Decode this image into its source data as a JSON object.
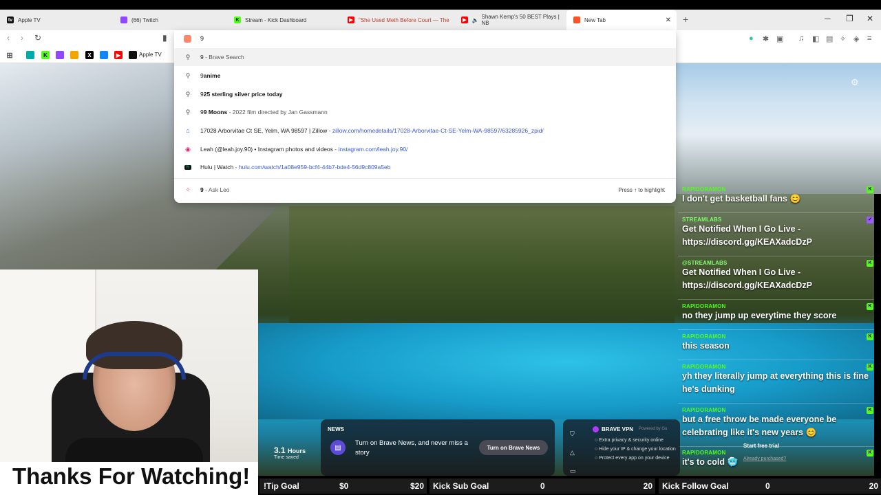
{
  "tabs": [
    {
      "label": "Apple TV",
      "icon": "apple-tv-icon",
      "color": "#111111"
    },
    {
      "label": "(66) Twitch",
      "icon": "twitch-icon",
      "color": "#9146ff"
    },
    {
      "label": "Stream - Kick Dashboard",
      "icon": "kick-icon",
      "color": "#53fc18"
    },
    {
      "label": "\"She Used Meth Before Court — The",
      "icon": "youtube-icon",
      "color": "#ff0000"
    },
    {
      "label": "Shawn Kemp's 50 BEST Plays | NB",
      "icon": "youtube-icon",
      "color": "#ff0000"
    },
    {
      "label": "New Tab",
      "icon": "brave-icon",
      "color": "#fb542b"
    }
  ],
  "bookmarks": {
    "apple_tv_label": "Apple TV"
  },
  "omnibox": {
    "query": "9",
    "suggestions": [
      {
        "icon": "search-icon",
        "title": "9",
        "sub": " - Brave Search"
      },
      {
        "icon": "search-icon",
        "title_pre": "9",
        "title_bold": "anime"
      },
      {
        "icon": "search-icon",
        "title_pre": "9",
        "title_bold": "25 sterling silver price today"
      },
      {
        "icon": "search-icon",
        "title_pre": "9",
        "title_bold": "9 Moons",
        "sub": " - 2022 film directed by Jan Gassmann"
      },
      {
        "icon": "zillow-icon",
        "title": "17028 Arborvitae Ct SE, Yelm, WA 98597 | Zillow",
        "sep": " - ",
        "url": "zillow.com/homedetails/17028-Arborvitae-Ct-SE-Yelm-WA-98597/63285926_zpid/"
      },
      {
        "icon": "instagram-icon",
        "title": "Leah (@leah.joy.90) • Instagram photos and videos",
        "sep": " - ",
        "url": "instagram.com/leah.joy.90/"
      },
      {
        "icon": "hulu-icon",
        "title": "Hulu | Watch",
        "sep": " - ",
        "url": "hulu.com/watch/1a08e959-bcf4-44b7-bde4-56d9c809a5eb"
      },
      {
        "icon": "ask-leo-icon",
        "title": "9",
        "sub": " - Ask Leo"
      }
    ],
    "press_hint": "Press ↑ to highlight"
  },
  "chat": [
    {
      "user": "RAPIDORAMON",
      "text": "I don't get basketball fans 😊"
    },
    {
      "user": "STREAMLABS",
      "text": "Get Notified When I Go Live - https://discord.gg/KEAXadcDzP"
    },
    {
      "user": "@STREAMLABS",
      "text": "Get Notified When I Go Live - https://discord.gg/KEAXadcDzP"
    },
    {
      "user": "RAPIDORAMON",
      "text": "no they jump up everytime they score"
    },
    {
      "user": "RAPIDORAMON",
      "text": "this season"
    },
    {
      "user": "RAPIDORAMON",
      "text": "yh they literally jump at everything this is fine he's dunking"
    },
    {
      "user": "RAPIDORAMON",
      "text": "but a free throw be made everyone be celebrating like it's new years 😊"
    },
    {
      "user": "RAPIDORAMON",
      "text": "it's to cold 🥶"
    }
  ],
  "stats": {
    "time_value": "3.1",
    "time_unit": "Hours",
    "time_label": "Time saved"
  },
  "news": {
    "header": "NEWS",
    "description": "Turn on Brave News, and never miss a story",
    "button": "Turn on Brave News"
  },
  "vpn": {
    "header": "BRAVE VPN",
    "powered": "Powered by Gu",
    "features": [
      "Extra privacy & security online",
      "Hide your IP & change your location",
      "Protect every app on your device"
    ],
    "start_trial": "Start free trial",
    "already": "Already purchased?"
  },
  "webcam": {
    "caption": "Thanks For Watching!"
  },
  "goals": [
    {
      "label": "!Tip Goal",
      "current": "$0",
      "target": "$20"
    },
    {
      "label": "Kick Sub Goal",
      "current": "0",
      "target": "20"
    },
    {
      "label": "Kick Follow Goal",
      "current": "0",
      "target": "20"
    }
  ]
}
